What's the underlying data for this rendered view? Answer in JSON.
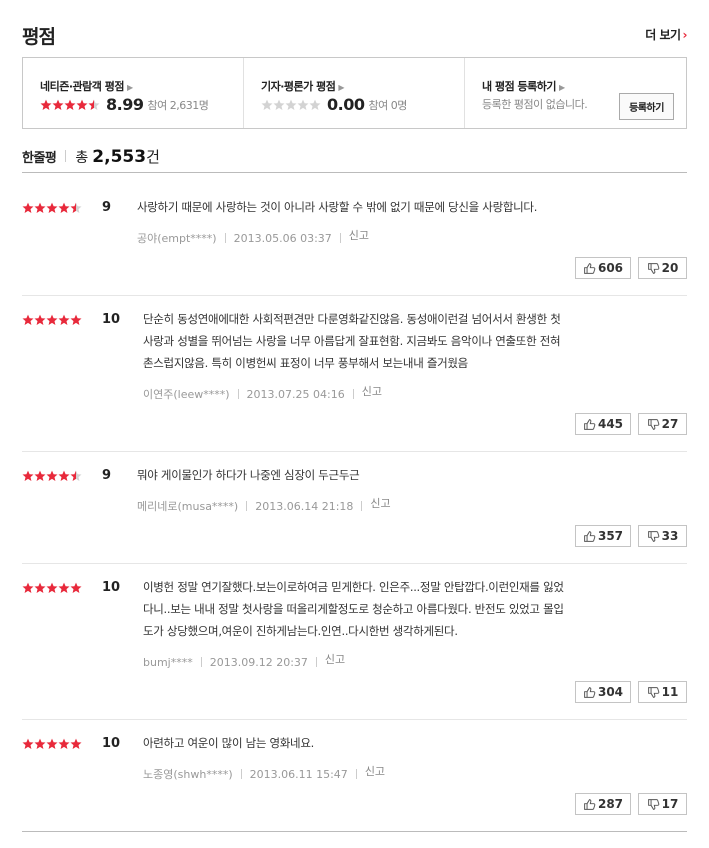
{
  "header": {
    "title": "평점",
    "more_label": "더 보기",
    "more_arrow": "›"
  },
  "summary": {
    "netizen": {
      "label": "네티즌·관람객 평점",
      "score": "8.99",
      "participants": "참여 2,631명",
      "stars": 4.5
    },
    "critic": {
      "label": "기자·평론가 평점",
      "score": "0.00",
      "participants": "참여 0명",
      "stars": 0
    },
    "mine": {
      "label": "내 평점 등록하기",
      "text": "등록한 평점이 없습니다.",
      "button": "등록하기"
    }
  },
  "count": {
    "label": "한줄평",
    "prefix": "총",
    "number": "2,553",
    "suffix": "건"
  },
  "colors": {
    "star_on": "#e8293b",
    "star_off": "#d3d3d3",
    "accent": "#e8293b"
  },
  "reviews": [
    {
      "stars": 4.5,
      "score": "9",
      "lines": [
        "사랑하기 때문에 사랑하는 것이 아니라 사랑할 수 밖에 없기 때문에 당신을 사랑합니다."
      ],
      "user": "공야(empt****)",
      "date": "2013.05.06 03:37",
      "report": "신고",
      "likes": "606",
      "dislikes": "20"
    },
    {
      "stars": 5,
      "score": "10",
      "lines": [
        "단순히 동성연애에대한 사회적편견만 다룬영화같진않음. 동성애이런걸 넘어서서 환생한 첫",
        "사랑과 성별을 뛰어넘는 사랑을 너무 아름답게 잘표현함. 지금봐도 음악이나 연출또한 전혀",
        "촌스럽지않음. 특히 이병헌씨 표정이 너무 풍부해서 보는내내 즐거웠음"
      ],
      "user": "이연주(leew****)",
      "date": "2013.07.25 04:16",
      "report": "신고",
      "likes": "445",
      "dislikes": "27"
    },
    {
      "stars": 4.5,
      "score": "9",
      "lines": [
        "뭐야 게이물인가 하다가 나중엔 심장이 두근두근"
      ],
      "user": "메리네로(musa****)",
      "date": "2013.06.14 21:18",
      "report": "신고",
      "likes": "357",
      "dislikes": "33"
    },
    {
      "stars": 5,
      "score": "10",
      "lines": [
        "이병헌 정말 연기잘했다.보는이로하여금 믿게한다. 인은주...정말 안탑깝다.이런인재를 잃었",
        "다니..보는 내내 정말 첫사랑을 떠올리게할정도로 청순하고 아름다웠다. 반전도 있었고 몰입",
        "도가 상당했으며,여운이 진하게남는다.인연..다시한번 생각하게된다."
      ],
      "user": "bumj****",
      "date": "2013.09.12 20:37",
      "report": "신고",
      "likes": "304",
      "dislikes": "11"
    },
    {
      "stars": 5,
      "score": "10",
      "lines": [
        "아련하고 여운이 많이 남는 영화네요."
      ],
      "user": "노종영(shwh****)",
      "date": "2013.06.11 15:47",
      "report": "신고",
      "likes": "287",
      "dislikes": "17"
    }
  ]
}
